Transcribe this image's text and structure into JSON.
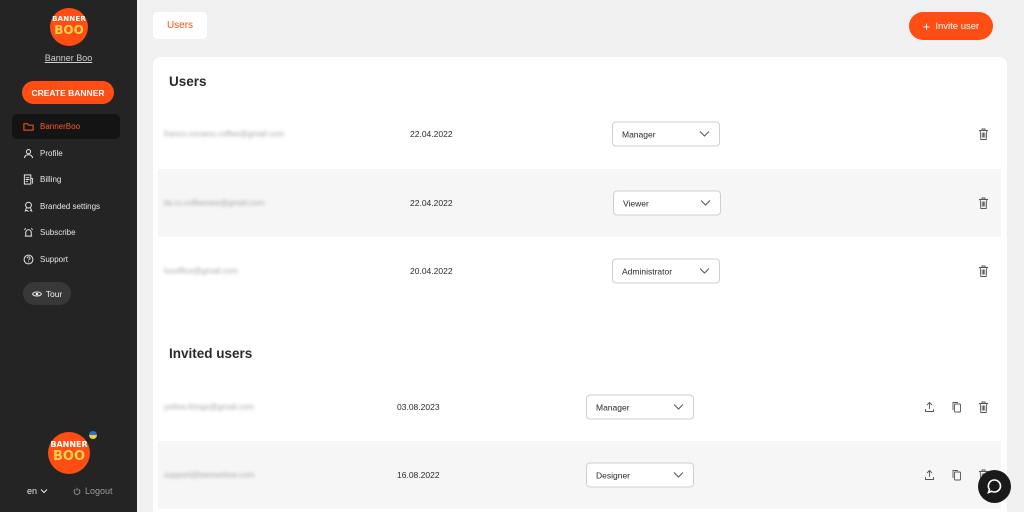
{
  "sidebar": {
    "logo": {
      "line1": "BANNER",
      "line2": "BOO"
    },
    "brand_name": "Banner Boo",
    "create_label": "CREATE BANNER",
    "nav": [
      {
        "label": "BannerBoo",
        "icon": "folder-icon",
        "active": true
      },
      {
        "label": "Profile",
        "icon": "user-icon",
        "active": false
      },
      {
        "label": "Billing",
        "icon": "billing-icon",
        "active": false
      },
      {
        "label": "Branded settings",
        "icon": "badge-icon",
        "active": false
      },
      {
        "label": "Subscribe",
        "icon": "alarm-icon",
        "active": false
      },
      {
        "label": "Support",
        "icon": "help-icon",
        "active": false
      }
    ],
    "tour_label": "Tour",
    "language": "en",
    "logout_label": "Logout"
  },
  "header": {
    "tab_label": "Users",
    "invite_label": "Invite user"
  },
  "users": {
    "title": "Users",
    "rows": [
      {
        "email": "franco.romano.coffee@gmail.com",
        "date": "22.04.2022",
        "role": "Manager"
      },
      {
        "email": "lia.ru.coffeenew@gmail.com",
        "date": "22.04.2022",
        "role": "Viewer"
      },
      {
        "email": "luxoffice@gmail.com",
        "date": "20.04.2022",
        "role": "Administrator"
      }
    ]
  },
  "invited": {
    "title": "Invited users",
    "rows": [
      {
        "email": "yellow.things@gmail.com",
        "date": "03.08.2023",
        "role": "Manager"
      },
      {
        "email": "support@bannerboo.com",
        "date": "16.08.2022",
        "role": "Designer"
      }
    ]
  },
  "colors": {
    "accent": "#ff4d14",
    "sidebar": "#242424"
  }
}
